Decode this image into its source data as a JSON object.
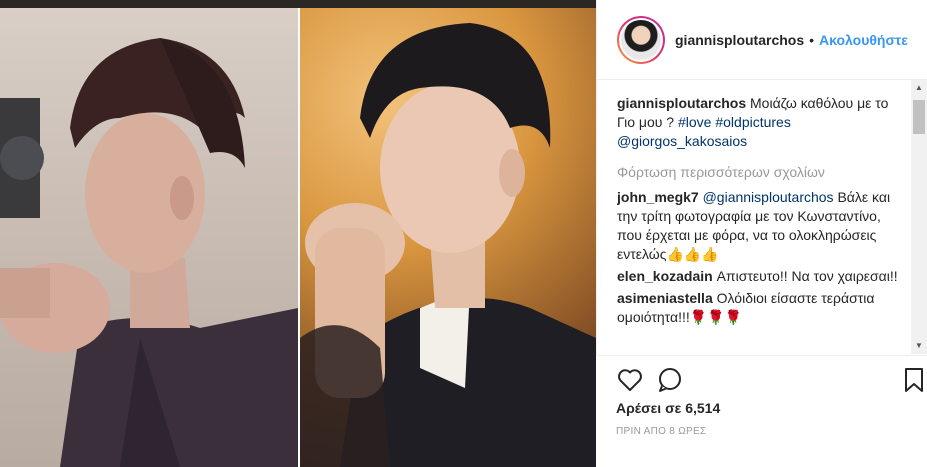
{
  "header": {
    "username": "giannisploutarchos",
    "separator": "•",
    "follow_label": "Ακολουθήστε"
  },
  "caption": {
    "username": "giannisploutarchos",
    "text": "Μοιάζω καθόλου με το Γιο μου ? ",
    "hashtags": [
      "#love",
      "#oldpictures"
    ],
    "mention": "@giorgos_kakosaios"
  },
  "load_more_label": "Φόρτωση περισσότερων σχολίων",
  "comments": [
    {
      "username": "john_megk7",
      "mention": "@giannisploutarchos",
      "text": " Βάλε και την τρίτη φωτογραφία με τον Κωνσταντίνο, που έρχεται με φόρα, να το ολοκληρώσεις εντελώς👍👍👍"
    },
    {
      "username": "elen_kozadain",
      "text": "Απιστευτο!! Να τον χαιρεσαι!!"
    },
    {
      "username": "asimeniastella",
      "text": "Ολόιδιοι είσαστε τεράστια ομοιότητα!!!🌹🌹🌹"
    }
  ],
  "likes_label": "Αρέσει σε 6,514",
  "timestamp": "ΠΡΙΝ ΑΠΟ 8 ΩΡΕΣ",
  "icons": {
    "like": "heart-icon",
    "comment": "comment-bubble-icon",
    "save": "bookmark-icon",
    "scroll_up": "arrow-up-icon",
    "scroll_down": "arrow-down-icon"
  },
  "colors": {
    "link": "#003569",
    "follow": "#3897f0",
    "muted": "#999999",
    "text": "#262626"
  }
}
